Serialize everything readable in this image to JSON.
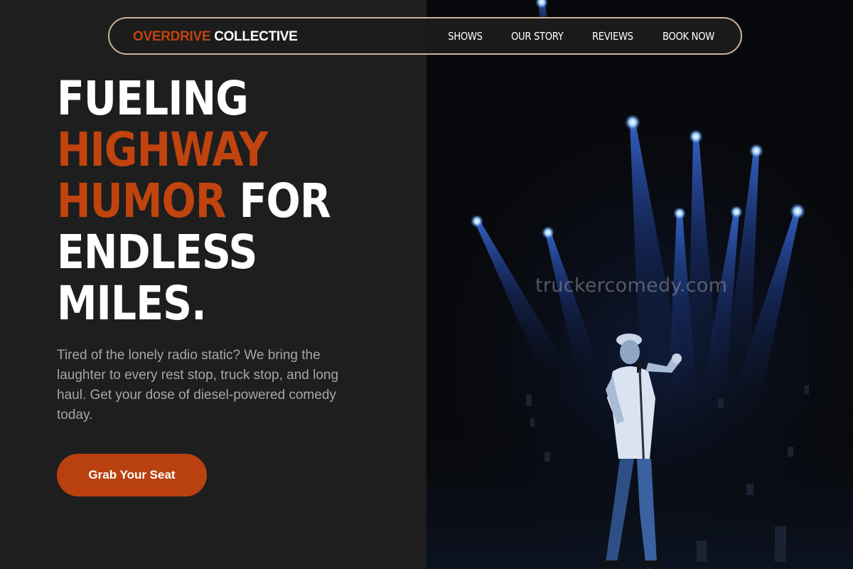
{
  "nav": {
    "brand_accent": "OVERDRIVE",
    "brand_main": "COLLECTIVE",
    "links": [
      "SHOWS",
      "OUR STORY",
      "REVIEWS",
      "BOOK NOW"
    ]
  },
  "hero": {
    "headline_1": "FUELING",
    "headline_2": "HIGHWAY",
    "headline_3a": "HUMOR",
    "headline_3b": " FOR",
    "headline_4": "ENDLESS",
    "headline_5": "MILES.",
    "subtext": "Tired of the lonely radio static? We bring the laughter to every rest stop, truck stop, and long haul. Get your dose of diesel-powered comedy today.",
    "cta_label": "Grab Your Seat"
  },
  "image": {
    "description_icon": "comedian-on-stage-photo",
    "watermark": "truckercomedy.com"
  },
  "colors": {
    "accent": "#c1440e",
    "background": "#1e1e1e",
    "nav_border": "#c9b59a"
  }
}
